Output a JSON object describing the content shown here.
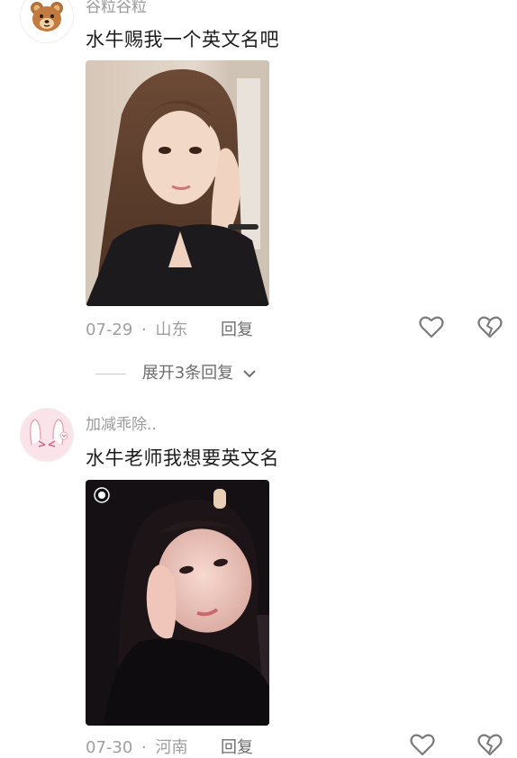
{
  "comments": [
    {
      "username": "谷粒谷粒",
      "text": "水牛赐我一个英文名吧",
      "date": "07-29",
      "separator": "·",
      "location": "山东",
      "reply_label": "回复",
      "expand_label": "展开3条回复"
    },
    {
      "username": "加减乖除..",
      "text": "水牛老师我想要英文名",
      "date": "07-30",
      "separator": "·",
      "location": "河南",
      "reply_label": "回复"
    }
  ],
  "icons": {
    "like": "heart-outline-icon",
    "dislike": "broken-heart-icon",
    "expand": "chevron-down-icon",
    "camera": "camera-lens-icon"
  },
  "colors": {
    "username": "#9a9a9a",
    "meta": "#9f9f9f",
    "action": "#6d6d6d"
  }
}
